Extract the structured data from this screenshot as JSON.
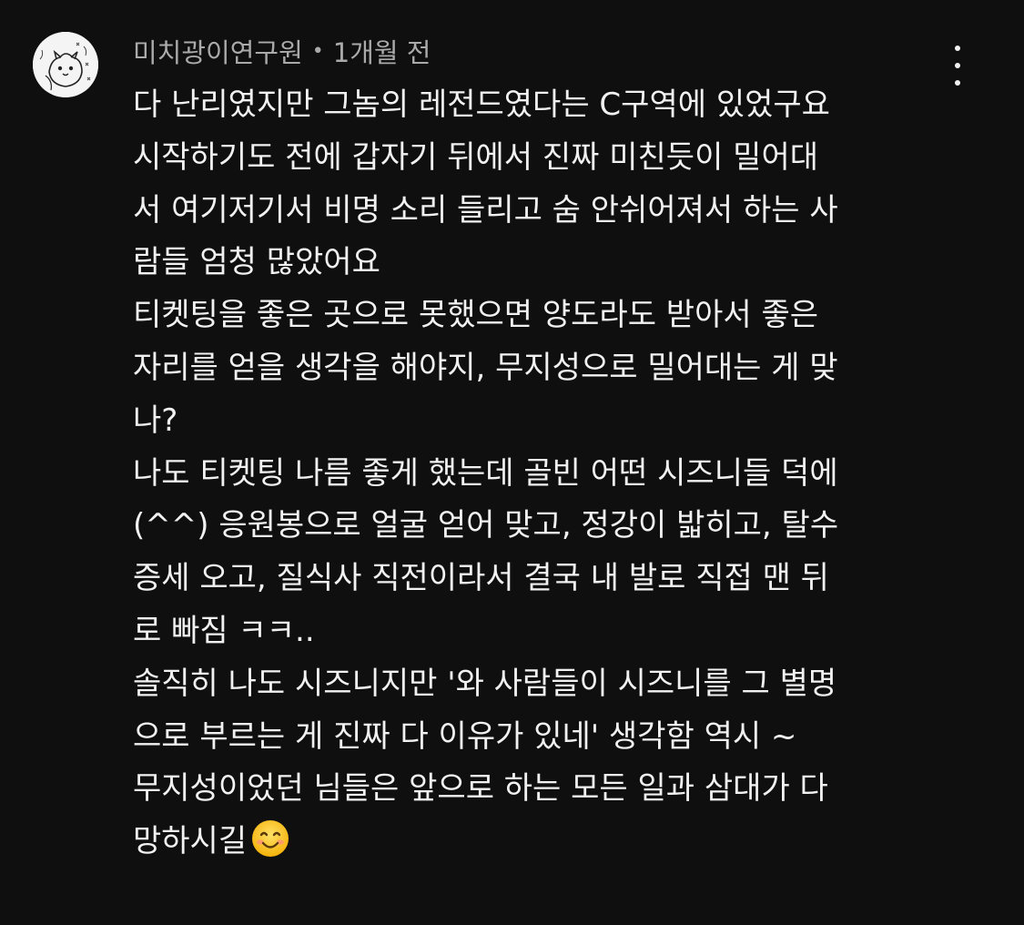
{
  "comment": {
    "author": "미치광이연구원",
    "separator": "•",
    "timestamp": "1개월 전",
    "lines": [
      "다 난리였지만 그놈의 레전드였다는 C구역에 있었구요",
      "시작하기도 전에 갑자기 뒤에서 진짜 미친듯이 밀어대",
      "서 여기저기서 비명 소리 들리고 숨 안쉬어져서 하는 사",
      "람들 엄청 많았어요",
      "티켓팅을 좋은 곳으로 못했으면 양도라도 받아서 좋은",
      "자리를 얻을 생각을 해야지, 무지성으로 밀어대는 게 맞",
      "나?",
      "나도 티켓팅 나름 좋게 했는데 골빈 어떤 시즈니들 덕에",
      "(^^) 응원봉으로 얼굴 얻어 맞고, 정강이 밟히고, 탈수",
      "증세 오고, 질식사 직전이라서 결국 내 발로 직접 맨 뒤",
      "로 빠짐 ㅋㅋ..",
      "솔직히 나도 시즈니지만 '와 사람들이 시즈니를 그 별명",
      "으로 부르는 게 진짜 다 이유가 있네' 생각함 역시 ~",
      "무지성이었던 님들은 앞으로 하는 모든 일과 삼대가 다",
      "망하시길"
    ],
    "trailing_emoji": "smiling-face-icon",
    "more_icon": "more-vertical-icon"
  },
  "colors": {
    "background": "#0f0f0f",
    "text": "#f1f1f1",
    "meta": "#aaaaaa"
  }
}
